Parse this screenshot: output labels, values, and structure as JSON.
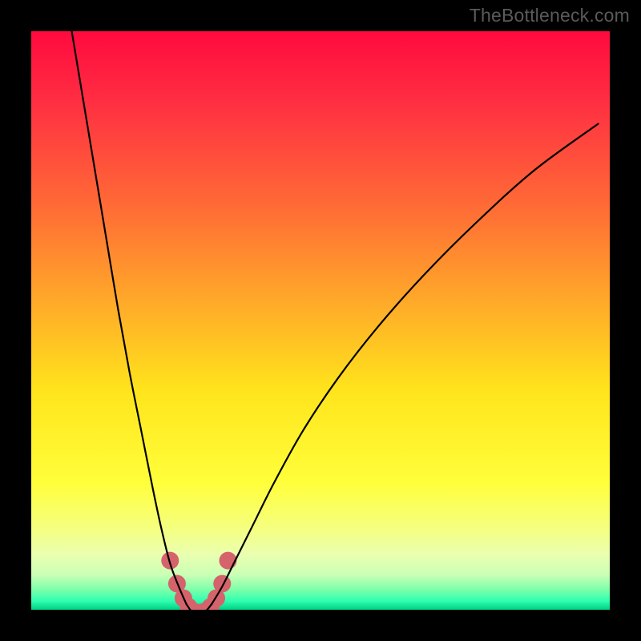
{
  "watermark": "TheBottleneck.com",
  "chart_data": {
    "type": "line",
    "title": "",
    "xlabel": "",
    "ylabel": "",
    "xlim": [
      0,
      100
    ],
    "ylim": [
      0,
      100
    ],
    "gradient_stops": [
      {
        "offset": 0,
        "color": "#ff0a3e"
      },
      {
        "offset": 0.12,
        "color": "#ff2e42"
      },
      {
        "offset": 0.3,
        "color": "#ff6a36"
      },
      {
        "offset": 0.48,
        "color": "#ffae28"
      },
      {
        "offset": 0.62,
        "color": "#ffe41c"
      },
      {
        "offset": 0.78,
        "color": "#ffff3a"
      },
      {
        "offset": 0.86,
        "color": "#f5ff80"
      },
      {
        "offset": 0.905,
        "color": "#eaffb0"
      },
      {
        "offset": 0.94,
        "color": "#c9ffb6"
      },
      {
        "offset": 0.965,
        "color": "#7dffaa"
      },
      {
        "offset": 0.985,
        "color": "#2effb0"
      },
      {
        "offset": 1.0,
        "color": "#00d084"
      }
    ],
    "series": [
      {
        "name": "left-curve",
        "x": [
          7,
          9,
          11,
          13,
          15,
          17,
          19,
          21,
          22.5,
          24,
          25.5,
          26.8
        ],
        "values": [
          100,
          88,
          76,
          64,
          52,
          41,
          31,
          21,
          14,
          8,
          4,
          1
        ]
      },
      {
        "name": "right-curve",
        "x": [
          31.2,
          33,
          35,
          38,
          42,
          47,
          53,
          60,
          68,
          77,
          87,
          98
        ],
        "values": [
          1,
          4,
          8,
          14,
          22,
          31,
          40,
          49,
          58,
          67,
          76,
          84
        ]
      },
      {
        "name": "bottom-arc",
        "x": [
          26.8,
          27.4,
          28.0,
          28.6,
          29.2,
          29.8,
          30.5,
          31.2
        ],
        "values": [
          1.0,
          0.1,
          -0.5,
          -0.7,
          -0.7,
          -0.5,
          0.1,
          1.0
        ]
      }
    ],
    "highlight": {
      "name": "marker-cluster",
      "color": "#d5636c",
      "points_x": [
        24.0,
        25.2,
        26.3,
        27.2,
        28.0,
        29.0,
        30.0,
        31.0,
        32.0,
        33.0,
        34.0
      ],
      "points_y": [
        8.5,
        4.5,
        2.0,
        0.5,
        -0.3,
        -0.5,
        -0.3,
        0.5,
        2.0,
        4.5,
        8.5
      ],
      "radius": 11
    }
  }
}
